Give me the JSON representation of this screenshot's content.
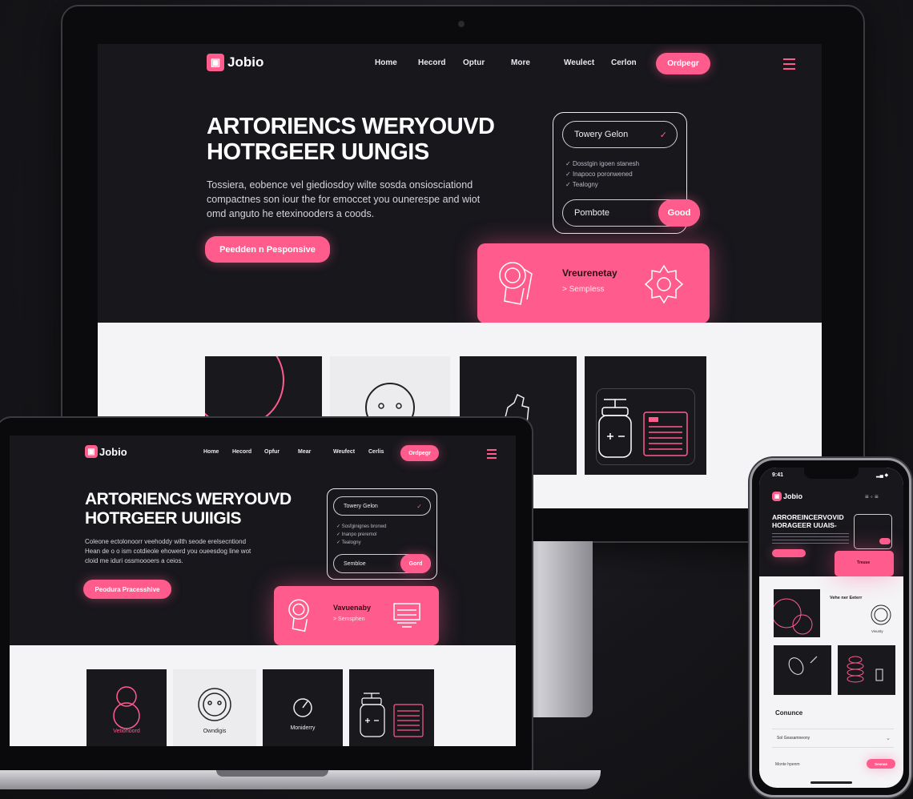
{
  "colors": {
    "accent": "#ff5c8d",
    "background": "#17171c",
    "band": "#f4f4f6"
  },
  "desktop": {
    "brand": "Jobio",
    "nav": [
      "Home",
      "Hecord",
      "Optur",
      "More",
      "Weulect",
      "Cerlon"
    ],
    "cta": "Ordpegr",
    "hero_title_1": "ARTORIENCS WERYOUVD",
    "hero_title_2": "HOTRGEER UUNGIS",
    "hero_body_1": "Tossiera, eobence vel giediosdoy wilte sosda onsiosciationd",
    "hero_body_2": "compactnes son iour the for emoccet you ounerespe and wiot",
    "hero_body_3": "omd anguto he etexinooders a coods.",
    "hero_button": "Peedden n Pesponsive",
    "form_select": "Towery Gelon",
    "form_checks": [
      "Dosstgin igoen stanesh",
      "Inapoco poronwened",
      "Tealogny"
    ],
    "form_input": "Pombote",
    "form_button": "Good",
    "pink_card_title": "Vreurenetay",
    "pink_card_sub": "> Sempless"
  },
  "laptop": {
    "brand": "Jobio",
    "nav": [
      "Home",
      "Hecord",
      "Opfur",
      "Mear",
      "Weufect",
      "Cerlis"
    ],
    "cta": "Ordpegr",
    "hero_title_1": "ARTORIENCS WERYOUVD",
    "hero_title_2": "HOTRGEER UUIIGIS",
    "hero_body_1": "Coleone ectolonoorr veehoddy wilth seode erelsecntiond",
    "hero_body_2": "Hean de o o ism cotdieole ehowerd you oueesdog line wot",
    "hero_body_3": "cloid me iduri ossmoooers a ceios.",
    "hero_button": "Peodura Pracesshive",
    "form_select": "Towery Gelon",
    "form_checks": [
      "Sosfginignes bronwd",
      "Inanpo preremol",
      "Tealogny"
    ],
    "form_input": "Sembloe",
    "form_button": "Gord",
    "pink_card_title": "Vavuenaby",
    "pink_card_sub": "> Semsphen",
    "tiles": [
      "Vetiohoord",
      "Owndigis",
      "Moniderry",
      ""
    ]
  },
  "phone": {
    "time": "9:41",
    "brand": "Jobio",
    "hero_title_1": "ARROREINCERVOVID",
    "hero_title_2": "HORAGEER UUAIS-",
    "card_title": "Vehe ner Eeterr",
    "card_sub": "Vivunty",
    "card_label": "Treuse",
    "section_title": "Conunce",
    "select_value": "Sol Geasamneony",
    "footer_label": "Monte hpenm",
    "footer_button": "Sevnse"
  }
}
